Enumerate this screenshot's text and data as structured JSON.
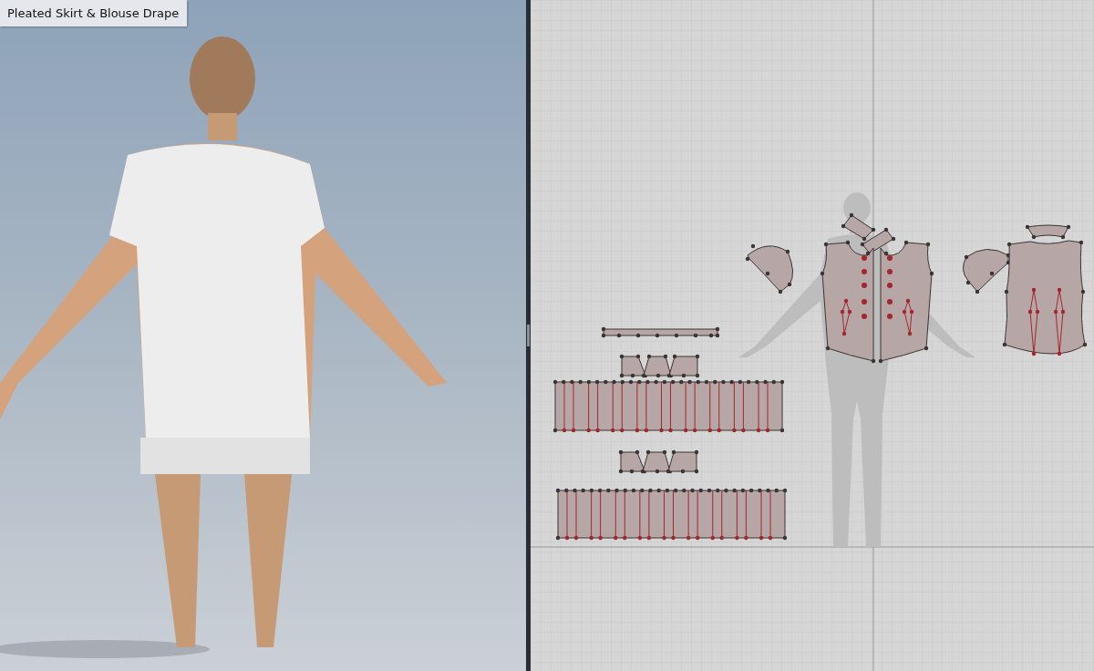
{
  "viewport": {
    "label": "Pleated Skirt & Blouse Drape"
  }
}
